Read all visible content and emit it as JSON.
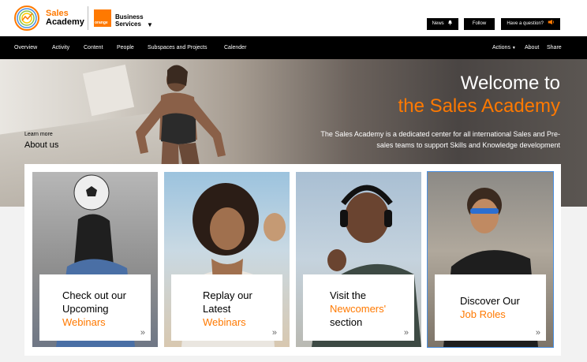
{
  "brand": {
    "line1": "Sales",
    "line2": "Academy",
    "orange_logo": "orange",
    "business_line1": "Business",
    "business_line2": "Services"
  },
  "top_buttons": {
    "news": "News",
    "follow": "Follow",
    "question": "Have a question?"
  },
  "nav": {
    "items": [
      "Overview",
      "Activity",
      "Content",
      "People",
      "Subspaces and Projects",
      "Calender"
    ],
    "right": [
      "Actions",
      "About",
      "Share"
    ]
  },
  "hero": {
    "title1": "Welcome to",
    "title2": "the Sales Academy",
    "description": "The Sales Academy is a dedicated center for all international Sales and Pre-sales teams to support Skills and Knowledge development",
    "learn_more": "Learn more",
    "about_us": "About us"
  },
  "cards": [
    {
      "line1": "Check out our",
      "line2": "Upcoming",
      "line3": "Webinars"
    },
    {
      "line1": "Replay our",
      "line2": "Latest",
      "line3": "Webinars"
    },
    {
      "line1": "Visit the",
      "line2": "Newcomers'",
      "line3": "section"
    },
    {
      "line1": "Discover Our",
      "line2": "Job Roles"
    }
  ],
  "colors": {
    "accent": "#ff7900",
    "nav_bg": "#000000",
    "selection": "#4a90e2"
  }
}
